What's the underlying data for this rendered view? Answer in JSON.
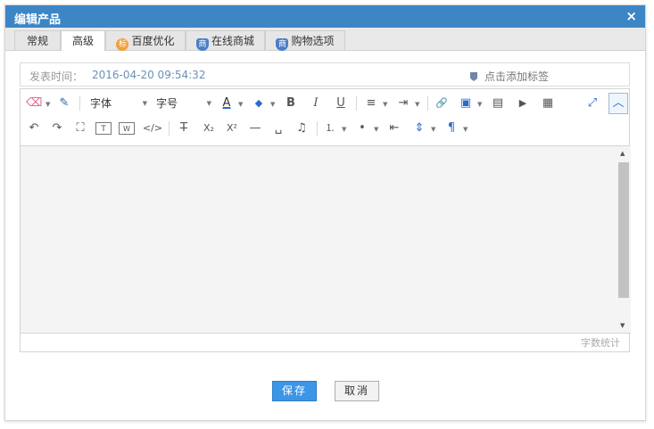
{
  "dialog": {
    "title": "编辑产品",
    "close_icon": "×"
  },
  "tabs": [
    {
      "label": "常规",
      "icon": ""
    },
    {
      "label": "高级",
      "icon": "",
      "active": true
    },
    {
      "label": "百度优化",
      "icon": "标",
      "icon_color": "#f0a13a"
    },
    {
      "label": "在线商城",
      "icon": "商",
      "icon_color": "#4b7ec8"
    },
    {
      "label": "购物选项",
      "icon": "商",
      "icon_color": "#4b7ec8"
    }
  ],
  "info": {
    "publish_label": "发表时间：",
    "publish_value": "2016-04-20 09:54:32",
    "tag_label": "点击添加标签"
  },
  "toolbar": {
    "font_family": "字体",
    "font_size": "字号",
    "icons": {
      "eraser": "⌫",
      "brush": "✎",
      "font_color": "A",
      "bg_color": "◆",
      "bold": "B",
      "italic": "I",
      "underline": "U",
      "align": "≡",
      "indent": "⇥",
      "link": "🔗",
      "image": "▣",
      "image_multi": "▤",
      "video": "▶",
      "table": "▦",
      "fullscreen": "⤢",
      "collapse": "︿",
      "undo": "↶",
      "redo": "↷",
      "select_all": "⛶",
      "text_block": "T",
      "word": "W",
      "code": "</>",
      "strikethrough": "T̶",
      "subscript": "X₂",
      "superscript": "X²",
      "hr": "—",
      "space": "␣",
      "music": "♫",
      "ordered_list": "⒈",
      "unordered_list": "•",
      "outdent": "⇤",
      "line_height": "⇕",
      "paragraph": "¶"
    }
  },
  "editor": {
    "word_count_label": "字数统计"
  },
  "buttons": {
    "save": "保存",
    "cancel": "取消"
  }
}
